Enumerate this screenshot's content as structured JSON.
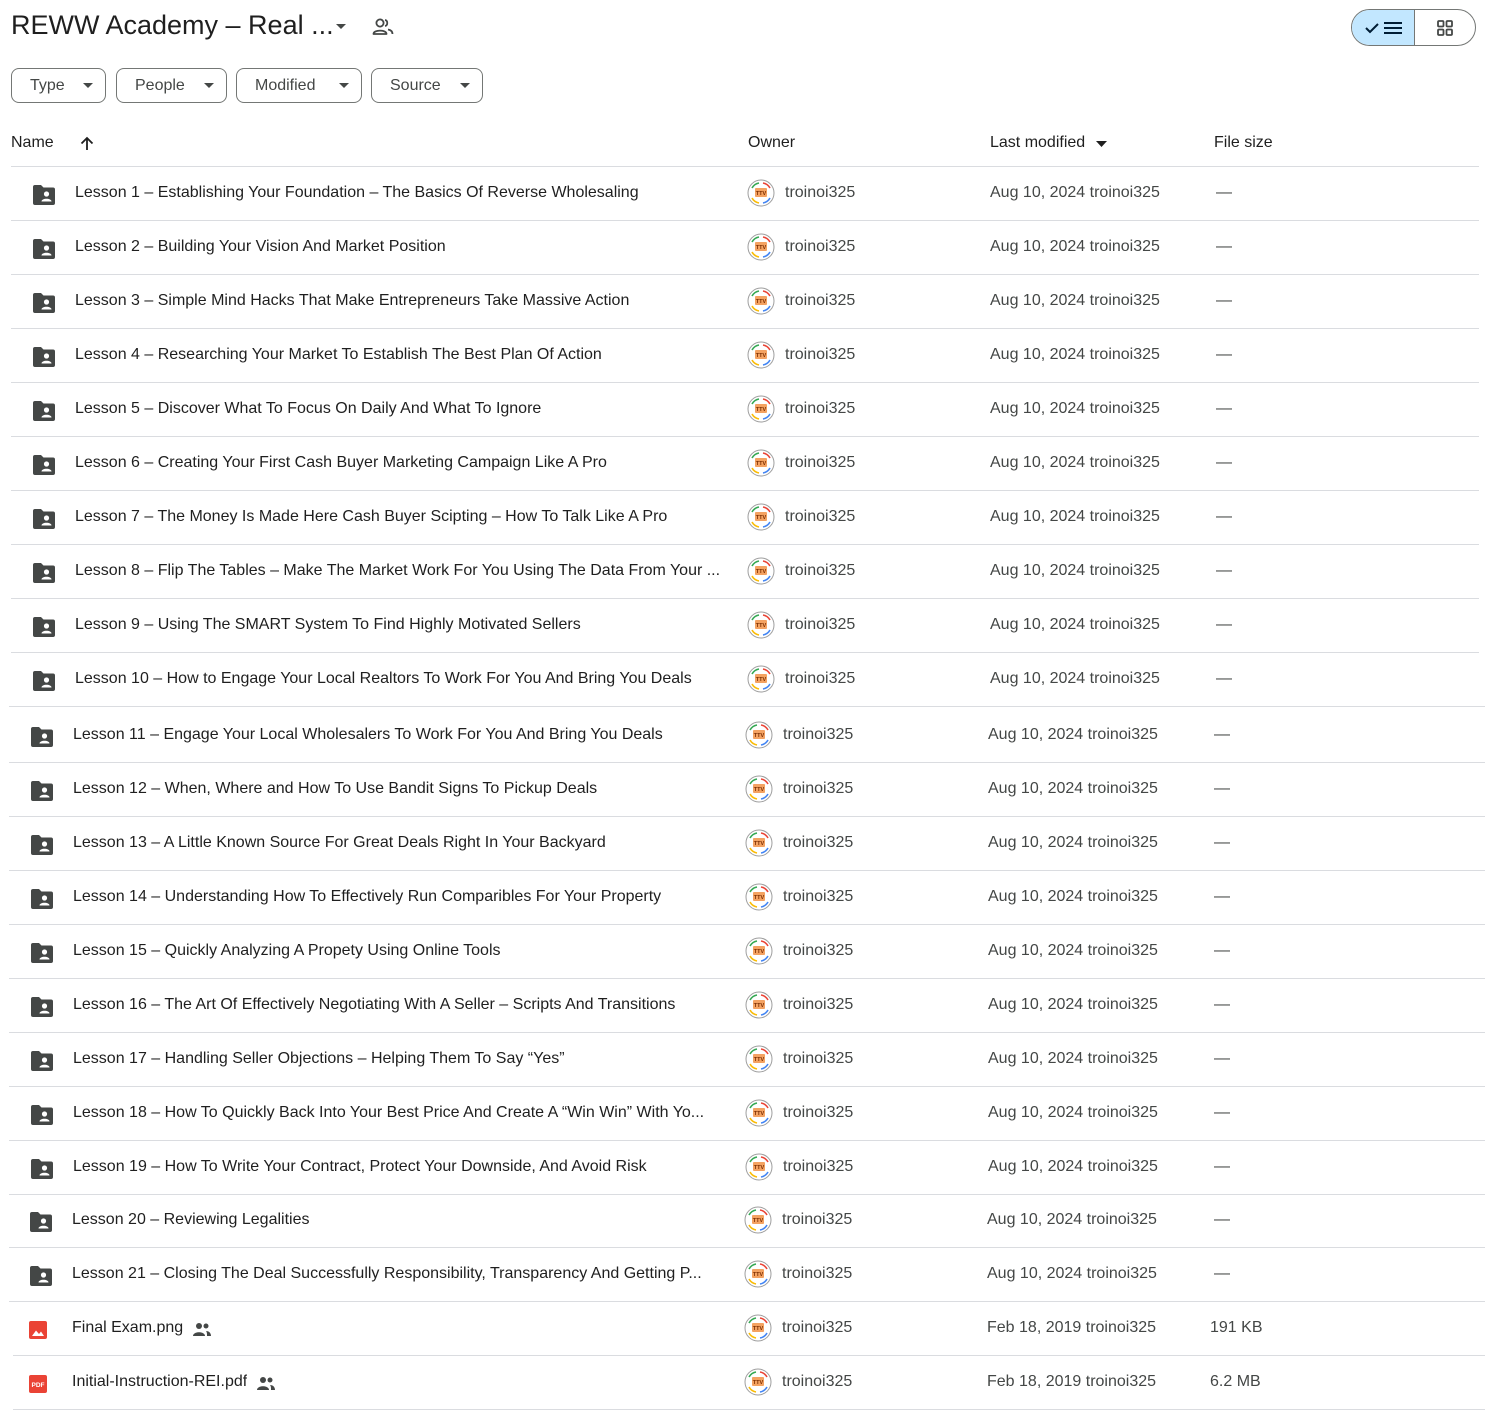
{
  "header": {
    "title": "REWW Academy – Real ...",
    "title_caret_icon": "arrow-drop-down-icon",
    "shared_icon": "people-icon",
    "view_toggle": {
      "list_selected": true,
      "list_icons": [
        "checkmark-icon",
        "list-view-icon"
      ],
      "grid_icon": "grid-view-icon"
    }
  },
  "filters": [
    {
      "label": "Type"
    },
    {
      "label": "People"
    },
    {
      "label": "Modified"
    },
    {
      "label": "Source"
    }
  ],
  "columns": {
    "name": "Name",
    "owner": "Owner",
    "last_modified": "Last modified",
    "file_size": "File size"
  },
  "colors": {
    "accent_selected": "#c2e7ff",
    "folder_icon": "#444746",
    "image_icon": "#ea4335",
    "pdf_icon": "#ea4335",
    "divider": "#dadce0"
  },
  "rows": [
    {
      "type": "folder",
      "name": "Lesson 1 – Establishing Your Foundation – The Basics Of Reverse Wholesaling",
      "owner": "troinoi325",
      "modified": "Aug 10, 2024 troinoi325",
      "size": "—",
      "shared": false
    },
    {
      "type": "folder",
      "name": "Lesson 2 – Building Your Vision And Market Position",
      "owner": "troinoi325",
      "modified": "Aug 10, 2024 troinoi325",
      "size": "—",
      "shared": false
    },
    {
      "type": "folder",
      "name": "Lesson 3 – Simple Mind Hacks That Make Entrepreneurs Take Massive Action",
      "owner": "troinoi325",
      "modified": "Aug 10, 2024 troinoi325",
      "size": "—",
      "shared": false
    },
    {
      "type": "folder",
      "name": "Lesson 4 – Researching Your Market To Establish The Best Plan Of Action",
      "owner": "troinoi325",
      "modified": "Aug 10, 2024 troinoi325",
      "size": "—",
      "shared": false
    },
    {
      "type": "folder",
      "name": "Lesson 5 – Discover What To Focus On Daily And What To Ignore",
      "owner": "troinoi325",
      "modified": "Aug 10, 2024 troinoi325",
      "size": "—",
      "shared": false
    },
    {
      "type": "folder",
      "name": "Lesson 6 – Creating Your First Cash Buyer Marketing Campaign Like A Pro",
      "owner": "troinoi325",
      "modified": "Aug 10, 2024 troinoi325",
      "size": "—",
      "shared": false
    },
    {
      "type": "folder",
      "name": "Lesson 7 – The Money Is Made Here Cash Buyer Scipting – How To Talk Like A Pro",
      "owner": "troinoi325",
      "modified": "Aug 10, 2024 troinoi325",
      "size": "—",
      "shared": false
    },
    {
      "type": "folder",
      "name": "Lesson 8 – Flip The Tables – Make The Market Work For You Using The Data From Your ...",
      "owner": "troinoi325",
      "modified": "Aug 10, 2024 troinoi325",
      "size": "—",
      "shared": false
    },
    {
      "type": "folder",
      "name": "Lesson 9 – Using The SMART System To Find Highly Motivated Sellers",
      "owner": "troinoi325",
      "modified": "Aug 10, 2024 troinoi325",
      "size": "—",
      "shared": false
    },
    {
      "type": "folder",
      "name": "Lesson 10 – How to Engage Your Local Realtors To Work For You And Bring You Deals",
      "owner": "troinoi325",
      "modified": "Aug 10, 2024 troinoi325",
      "size": "—",
      "shared": false
    },
    {
      "type": "folder",
      "name": "Lesson 11 – Engage Your Local Wholesalers To Work For You And Bring You Deals",
      "owner": "troinoi325",
      "modified": "Aug 10, 2024 troinoi325",
      "size": "—",
      "shared": false
    },
    {
      "type": "folder",
      "name": "Lesson 12 – When, Where and How To Use Bandit Signs To Pickup Deals",
      "owner": "troinoi325",
      "modified": "Aug 10, 2024 troinoi325",
      "size": "—",
      "shared": false
    },
    {
      "type": "folder",
      "name": "Lesson 13 – A Little Known Source For Great Deals Right In Your Backyard",
      "owner": "troinoi325",
      "modified": "Aug 10, 2024 troinoi325",
      "size": "—",
      "shared": false
    },
    {
      "type": "folder",
      "name": "Lesson 14 – Understanding How To Effectively Run Comparibles For Your Property",
      "owner": "troinoi325",
      "modified": "Aug 10, 2024 troinoi325",
      "size": "—",
      "shared": false
    },
    {
      "type": "folder",
      "name": "Lesson 15 – Quickly Analyzing A Propety Using Online Tools",
      "owner": "troinoi325",
      "modified": "Aug 10, 2024 troinoi325",
      "size": "—",
      "shared": false
    },
    {
      "type": "folder",
      "name": "Lesson 16 – The Art Of Effectively Negotiating With A Seller – Scripts And Transitions",
      "owner": "troinoi325",
      "modified": "Aug 10, 2024 troinoi325",
      "size": "—",
      "shared": false
    },
    {
      "type": "folder",
      "name": "Lesson 17 – Handling Seller Objections – Helping Them To Say “Yes”",
      "owner": "troinoi325",
      "modified": "Aug 10, 2024 troinoi325",
      "size": "—",
      "shared": false
    },
    {
      "type": "folder",
      "name": "Lesson 18 – How To Quickly Back Into Your Best Price And Create A “Win Win” With Yo...",
      "owner": "troinoi325",
      "modified": "Aug 10, 2024 troinoi325",
      "size": "—",
      "shared": false
    },
    {
      "type": "folder",
      "name": "Lesson 19 – How To Write Your Contract, Protect Your Downside, And Avoid Risk",
      "owner": "troinoi325",
      "modified": "Aug 10, 2024 troinoi325",
      "size": "—",
      "shared": false
    },
    {
      "type": "folder",
      "name": "Lesson 20 – Reviewing Legalities",
      "owner": "troinoi325",
      "modified": "Aug 10, 2024 troinoi325",
      "size": "—",
      "shared": false
    },
    {
      "type": "folder",
      "name": "Lesson 21 – Closing The Deal Successfully Responsibility, Transparency And Getting P...",
      "owner": "troinoi325",
      "modified": "Aug 10, 2024 troinoi325",
      "size": "—",
      "shared": false
    },
    {
      "type": "image",
      "name": "Final Exam.png",
      "owner": "troinoi325",
      "modified": "Feb 18, 2019 troinoi325",
      "size": "191 KB",
      "shared": true
    },
    {
      "type": "pdf",
      "name": "Initial-Instruction-REI.pdf",
      "owner": "troinoi325",
      "modified": "Feb 18, 2019 troinoi325",
      "size": "6.2 MB",
      "shared": true
    }
  ]
}
